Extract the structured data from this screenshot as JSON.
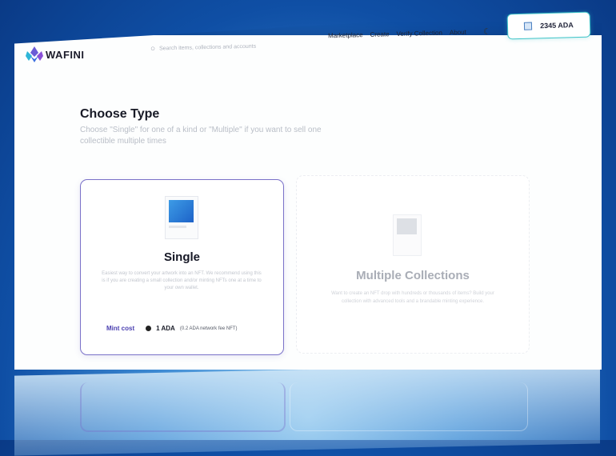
{
  "brand": {
    "name": "WAFINI"
  },
  "search": {
    "placeholder": "Search items, collections and accounts"
  },
  "nav": {
    "items": [
      "Marketplace",
      "Create",
      "Verify Collection",
      "About"
    ]
  },
  "wallet": {
    "amount": "2345 ADA"
  },
  "page": {
    "title": "Choose Type",
    "subtitle": "Choose \"Single\" for one of a kind or \"Multiple\" if you want to sell one collectible multiple times"
  },
  "single_card": {
    "title": "Single",
    "description": "Easiest way to convert your artwork into an NFT. We recommend using this is if you are creating a small collection and/or minting NFTs one at a time to your own wallet.",
    "mint_label": "Mint cost",
    "mint_value": "1 ADA",
    "mint_note": "(0.2 ADA network fee NFT)"
  },
  "multi_card": {
    "title": "Multiple Collections",
    "description": "Want to create an NFT drop with hundreds or thousands of items? Build your collection with advanced tools and a brandable minting experience."
  },
  "colors": {
    "accent": "#4a3fb0",
    "card_border": "#7a71c8",
    "wallet_border": "#3fc4c8",
    "background": "#0f4fa5"
  }
}
